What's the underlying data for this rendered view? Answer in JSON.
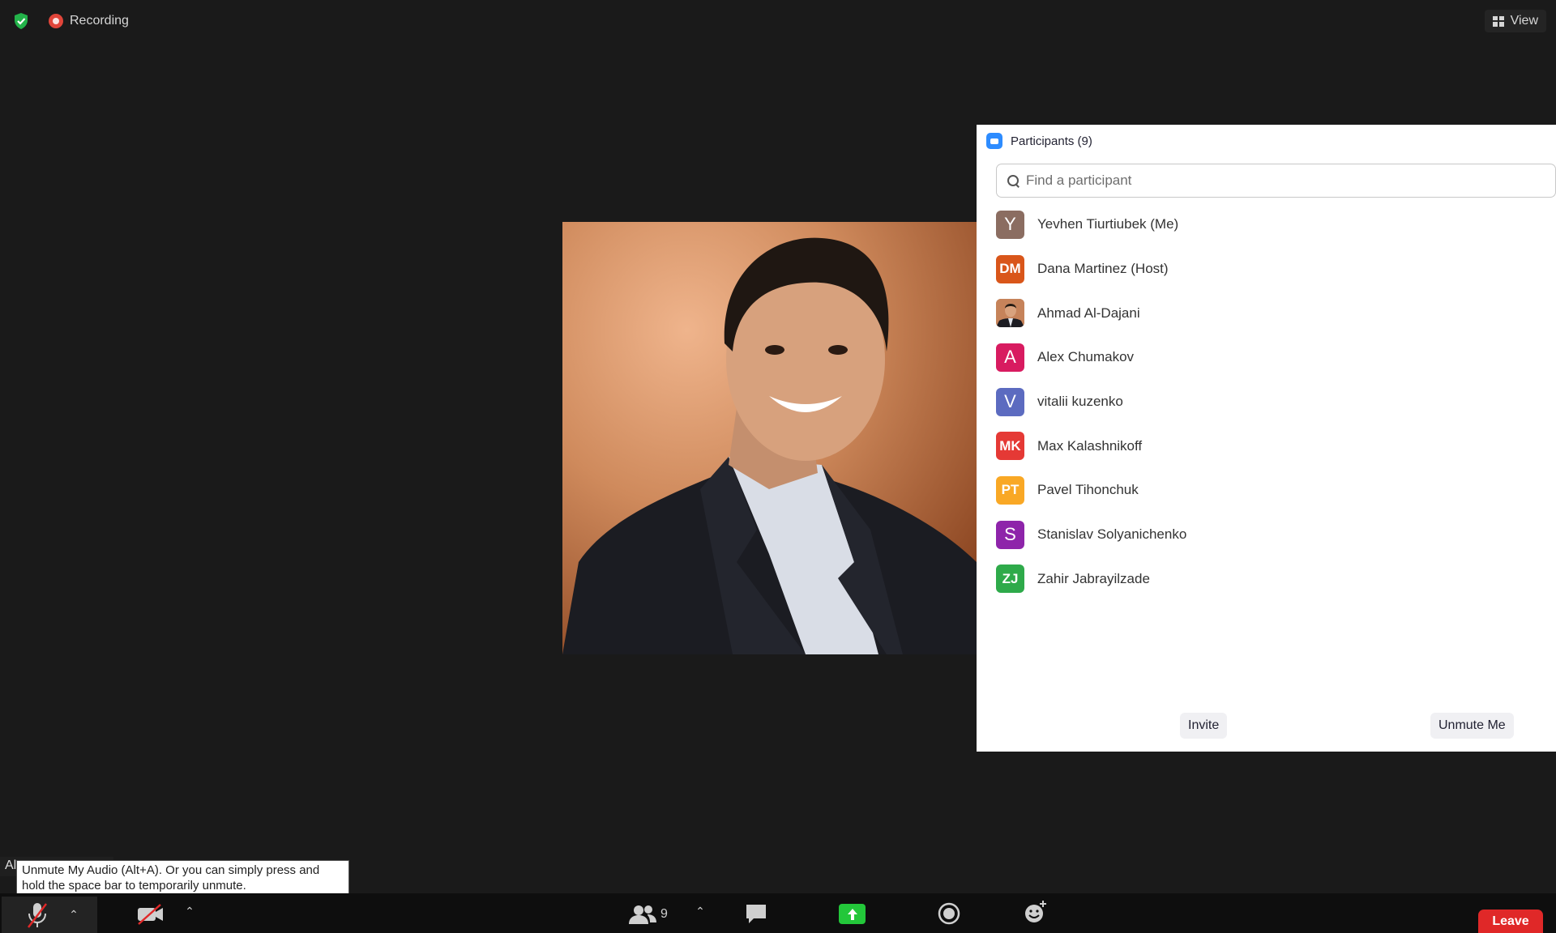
{
  "topbar": {
    "recording_label": "Recording",
    "view_label": "View"
  },
  "panel": {
    "title": "Participants (9)",
    "search_placeholder": "Find a participant",
    "participants": [
      {
        "name": "Yevhen Tiurtiubek (Me)",
        "initials": "Y",
        "color": "#8b6d61"
      },
      {
        "name": "Dana Martinez (Host)",
        "initials": "DM",
        "color": "#d9561a"
      },
      {
        "name": "Ahmad Al-Dajani",
        "initials": "",
        "color": "#8a5a3a",
        "photo": true
      },
      {
        "name": "Alex Chumakov",
        "initials": "A",
        "color": "#d81b60"
      },
      {
        "name": "vitalii kuzenko",
        "initials": "V",
        "color": "#5c6bc0"
      },
      {
        "name": "Max Kalashnikoff",
        "initials": "MK",
        "color": "#e53935"
      },
      {
        "name": "Pavel Tihonchuk",
        "initials": "PT",
        "color": "#f9a825"
      },
      {
        "name": "Stanislav Solyanichenko",
        "initials": "S",
        "color": "#8e24aa"
      },
      {
        "name": "Zahir Jabrayilzade",
        "initials": "ZJ",
        "color": "#2eaa4a"
      }
    ],
    "invite_label": "Invite",
    "unmute_me_label": "Unmute Me"
  },
  "tooltip": {
    "text": "Unmute My Audio (Alt+A). Or you can simply press and hold the space bar to temporarily unmute.",
    "underlying_label": "Al"
  },
  "toolbar": {
    "participants_count": "9",
    "leave_label": "Leave",
    "share_color": "#23c73a",
    "leave_color": "#e02828"
  }
}
